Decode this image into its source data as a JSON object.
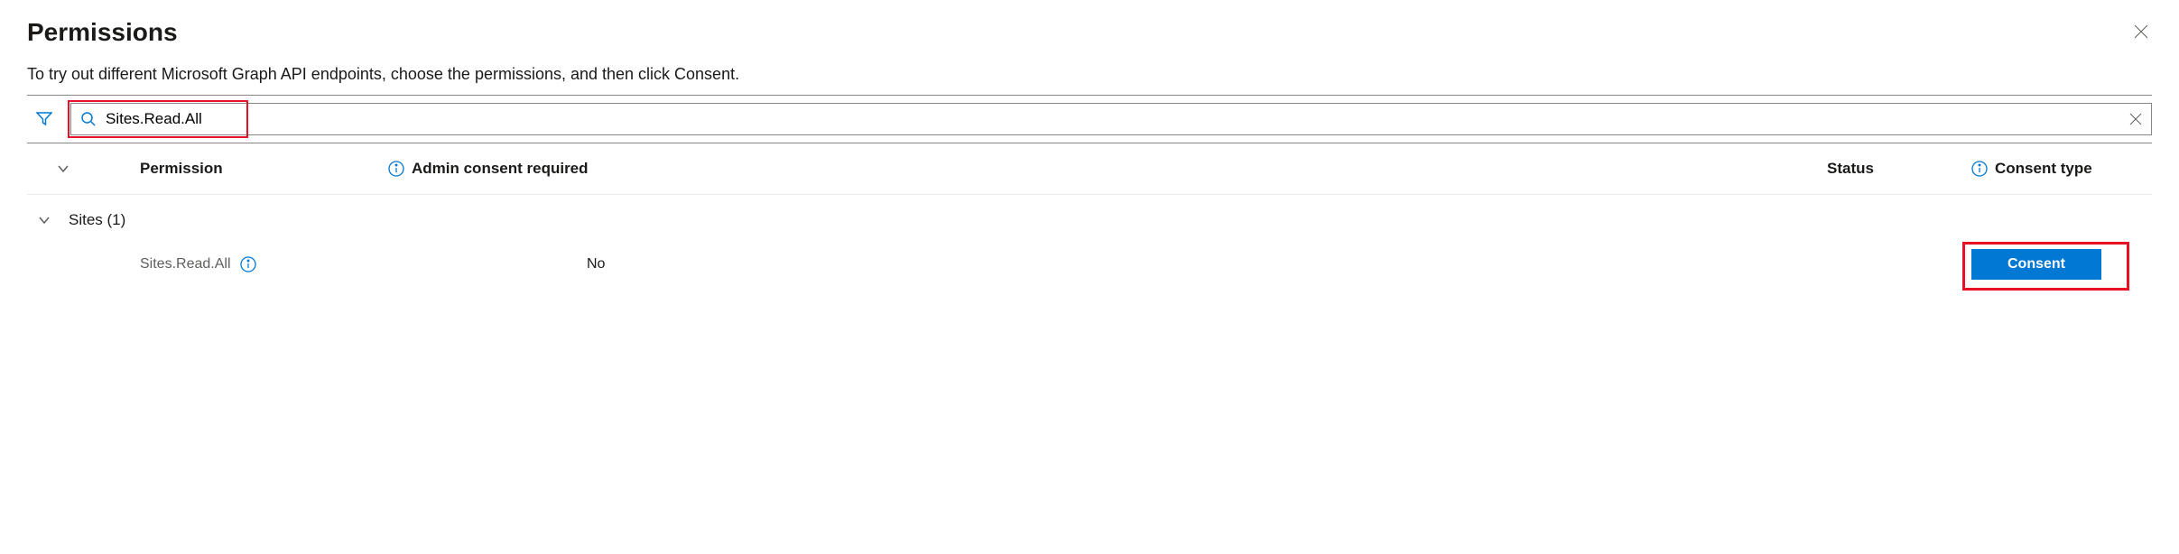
{
  "header": {
    "title": "Permissions"
  },
  "description": "To try out different Microsoft Graph API endpoints, choose the permissions, and then click Consent.",
  "search": {
    "value": "Sites.Read.All"
  },
  "columns": {
    "permission": "Permission",
    "admin_consent": "Admin consent required",
    "status": "Status",
    "consent_type": "Consent type"
  },
  "groups": [
    {
      "name": "Sites (1)",
      "rows": [
        {
          "permission": "Sites.Read.All",
          "admin_consent_required": "No",
          "status": "",
          "action_label": "Consent"
        }
      ]
    }
  ]
}
